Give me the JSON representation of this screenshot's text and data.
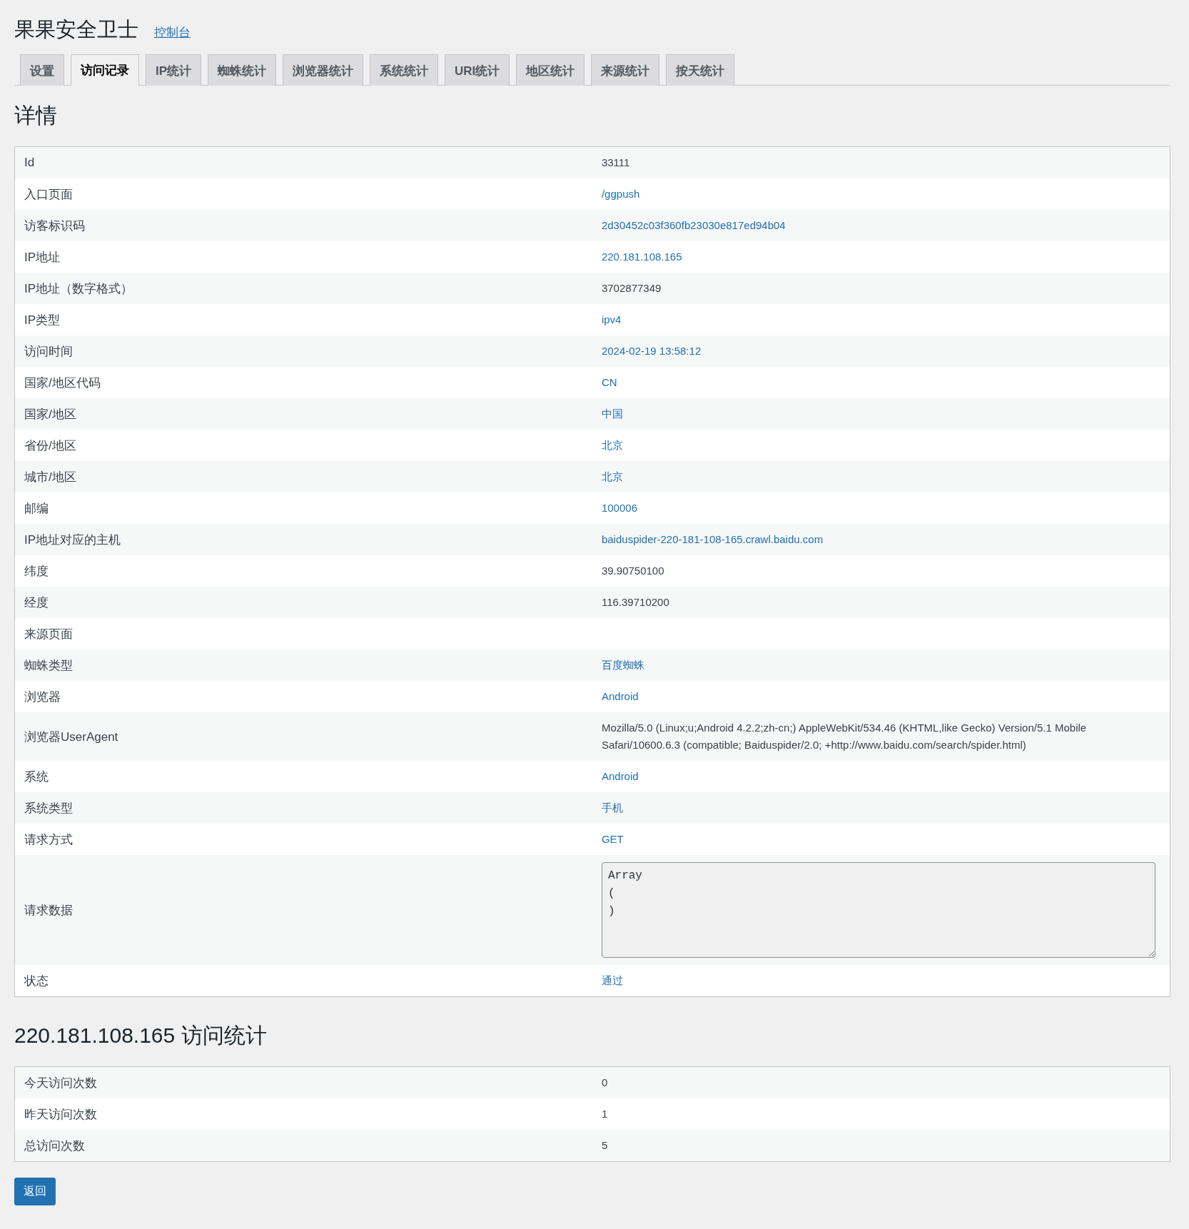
{
  "header": {
    "title": "果果安全卫士",
    "link": "控制台"
  },
  "tabs": [
    {
      "label": "设置",
      "selected": false
    },
    {
      "label": "访问记录",
      "selected": true
    },
    {
      "label": "IP统计",
      "selected": false
    },
    {
      "label": "蜘蛛统计",
      "selected": false
    },
    {
      "label": "浏览器统计",
      "selected": false
    },
    {
      "label": "系统统计",
      "selected": false
    },
    {
      "label": "URI统计",
      "selected": false
    },
    {
      "label": "地区统计",
      "selected": false
    },
    {
      "label": "来源统计",
      "selected": false
    },
    {
      "label": "按天统计",
      "selected": false
    }
  ],
  "details": {
    "heading": "详情",
    "rows": [
      {
        "label": "Id",
        "value": "33111",
        "kind": "text"
      },
      {
        "label": "入口页面",
        "value": "/ggpush",
        "kind": "link"
      },
      {
        "label": "访客标识码",
        "value": "2d30452c03f360fb23030e817ed94b04",
        "kind": "link"
      },
      {
        "label": "IP地址",
        "value": "220.181.108.165",
        "kind": "link"
      },
      {
        "label": "IP地址（数字格式）",
        "value": "3702877349",
        "kind": "text"
      },
      {
        "label": "IP类型",
        "value": "ipv4",
        "kind": "link"
      },
      {
        "label": "访问时间",
        "value": "2024-02-19 13:58:12",
        "kind": "link"
      },
      {
        "label": "国家/地区代码",
        "value": "CN",
        "kind": "link"
      },
      {
        "label": "国家/地区",
        "value": "中国",
        "kind": "link"
      },
      {
        "label": "省份/地区",
        "value": "北京",
        "kind": "link"
      },
      {
        "label": "城市/地区",
        "value": "北京",
        "kind": "link"
      },
      {
        "label": "邮编",
        "value": "100006",
        "kind": "link"
      },
      {
        "label": "IP地址对应的主机",
        "value": "baiduspider-220-181-108-165.crawl.baidu.com",
        "kind": "link"
      },
      {
        "label": "纬度",
        "value": "39.90750100",
        "kind": "text"
      },
      {
        "label": "经度",
        "value": "116.39710200",
        "kind": "text"
      },
      {
        "label": "来源页面",
        "kind": "empty"
      },
      {
        "label": "蜘蛛类型",
        "value": "百度蜘蛛",
        "kind": "link"
      },
      {
        "label": "浏览器",
        "value": "Android",
        "kind": "link"
      },
      {
        "label": "浏览器UserAgent",
        "value": "Mozilla/5.0 (Linux;u;Android 4.2.2;zh-cn;) AppleWebKit/534.46 (KHTML,like Gecko) Version/5.1 Mobile Safari/10600.6.3 (compatible; Baiduspider/2.0; +http://www.baidu.com/search/spider.html)",
        "kind": "text"
      },
      {
        "label": "系统",
        "value": "Android",
        "kind": "link"
      },
      {
        "label": "系统类型",
        "value": "手机",
        "kind": "link"
      },
      {
        "label": "请求方式",
        "value": "GET",
        "kind": "link"
      },
      {
        "label": "请求数据",
        "value": "Array\n(\n)",
        "kind": "textarea"
      },
      {
        "label": "状态",
        "value": "通过",
        "kind": "link"
      }
    ]
  },
  "stats": {
    "heading": "220.181.108.165 访问统计",
    "rows": [
      {
        "label": "今天访问次数",
        "value": "0"
      },
      {
        "label": "昨天访问次数",
        "value": "1"
      },
      {
        "label": "总访问次数",
        "value": "5"
      }
    ]
  },
  "back_button": "返回"
}
